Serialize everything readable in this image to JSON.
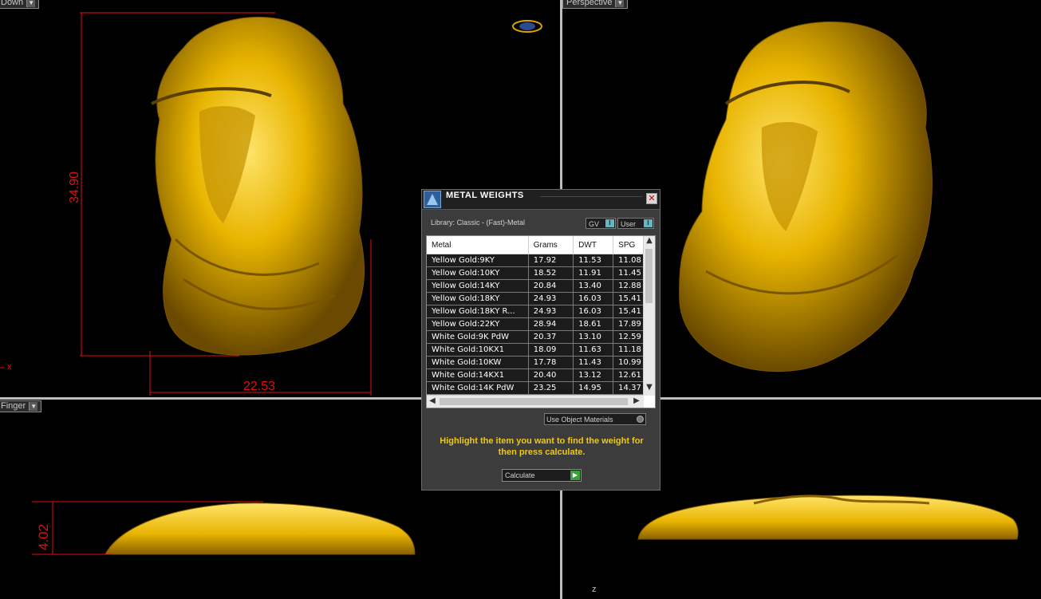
{
  "viewports": {
    "top_left_label": "Down",
    "top_right_label": "Perspective",
    "bottom_left_label": "Finger",
    "axis_x": "x",
    "axis_z": "z"
  },
  "dimensions": {
    "height": "34.90",
    "width": "22.53",
    "thickness": "4.02"
  },
  "dialog": {
    "title": "METAL WEIGHTS",
    "library": "Library: Classic - (Fast)-Metal",
    "gv_label": "GV",
    "user_label": "User",
    "columns": [
      "Metal",
      "Grams",
      "DWT",
      "SPG"
    ],
    "rows": [
      [
        "Yellow Gold:9KY",
        "17.92",
        "11.53",
        "11.08"
      ],
      [
        "Yellow Gold:10KY",
        "18.52",
        "11.91",
        "11.45"
      ],
      [
        "Yellow Gold:14KY",
        "20.84",
        "13.40",
        "12.88"
      ],
      [
        "Yellow Gold:18KY",
        "24.93",
        "16.03",
        "15.41"
      ],
      [
        "Yellow Gold:18KY R...",
        "24.93",
        "16.03",
        "15.41"
      ],
      [
        "Yellow Gold:22KY",
        "28.94",
        "18.61",
        "17.89"
      ],
      [
        "White Gold:9K PdW",
        "20.37",
        "13.10",
        "12.59"
      ],
      [
        "White Gold:10KX1",
        "18.09",
        "11.63",
        "11.18"
      ],
      [
        "White Gold:10KW",
        "17.78",
        "11.43",
        "10.99"
      ],
      [
        "White Gold:14KX1",
        "20.40",
        "13.12",
        "12.61"
      ],
      [
        "White Gold:14K PdW",
        "23.25",
        "14.95",
        "14.37"
      ]
    ],
    "material_select": "Use Object Materials",
    "hint": "Highlight the item you want to find the weight for then press calculate.",
    "calculate_label": "Calculate"
  },
  "colors": {
    "gold": "#e8b400",
    "dimension_red": "#e01010",
    "hint_yellow": "#f0c814"
  }
}
